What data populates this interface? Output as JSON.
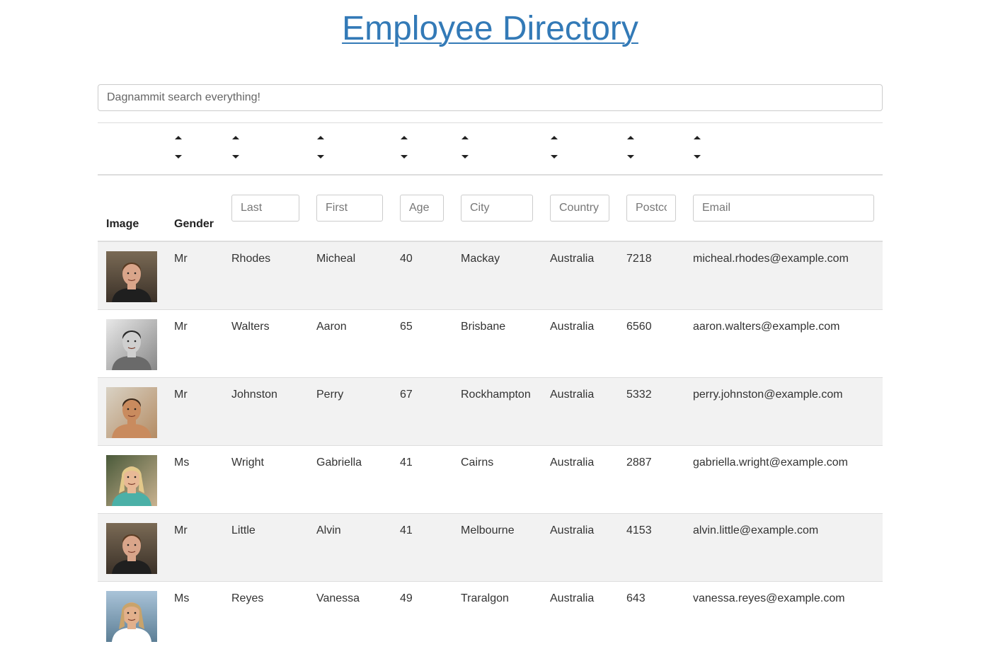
{
  "page": {
    "title": "Employee Directory",
    "search_placeholder": "Dagnammit search everything!"
  },
  "table": {
    "headers": {
      "image": "Image",
      "gender": "Gender"
    },
    "filter_placeholders": {
      "last": "Last",
      "first": "First",
      "age": "Age",
      "city": "City",
      "country": "Country",
      "postcode": "Postcode",
      "email": "Email"
    },
    "rows": [
      {
        "avatar": "male-portrait-dark-hair",
        "gender": "Mr",
        "last": "Rhodes",
        "first": "Micheal",
        "age": "40",
        "city": "Mackay",
        "country": "Australia",
        "postcode": "7218",
        "email": "micheal.rhodes@example.com"
      },
      {
        "avatar": "male-portrait-bw",
        "gender": "Mr",
        "last": "Walters",
        "first": "Aaron",
        "age": "65",
        "city": "Brisbane",
        "country": "Australia",
        "postcode": "6560",
        "email": "aaron.walters@example.com"
      },
      {
        "avatar": "male-portrait-closeup",
        "gender": "Mr",
        "last": "Johnston",
        "first": "Perry",
        "age": "67",
        "city": "Rockhampton",
        "country": "Australia",
        "postcode": "5332",
        "email": "perry.johnston@example.com"
      },
      {
        "avatar": "female-portrait-blonde",
        "gender": "Ms",
        "last": "Wright",
        "first": "Gabriella",
        "age": "41",
        "city": "Cairns",
        "country": "Australia",
        "postcode": "2887",
        "email": "gabriella.wright@example.com"
      },
      {
        "avatar": "male-portrait-dark-hair",
        "gender": "Mr",
        "last": "Little",
        "first": "Alvin",
        "age": "41",
        "city": "Melbourne",
        "country": "Australia",
        "postcode": "4153",
        "email": "alvin.little@example.com"
      },
      {
        "avatar": "female-portrait-outdoor",
        "gender": "Ms",
        "last": "Reyes",
        "first": "Vanessa",
        "age": "49",
        "city": "Traralgon",
        "country": "Australia",
        "postcode": "643",
        "email": "vanessa.reyes@example.com"
      }
    ]
  }
}
